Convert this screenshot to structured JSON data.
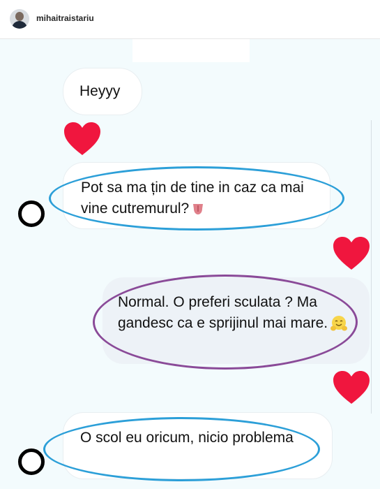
{
  "header": {
    "username": "mihaitraistariu"
  },
  "messages": [
    {
      "text": "Heyyy"
    },
    {
      "text": "Pot sa ma țin de tine in caz ca mai vine cutremurul?",
      "emoji_icon": "tongue-emoji-icon"
    },
    {
      "text": "Normal. O preferi sculata ? Ma gandesc ca e sprijinul mai mare.",
      "emoji_icon": "hugging-face-emoji-icon"
    },
    {
      "text": "O scol eu oricum, nicio problema"
    }
  ],
  "colors": {
    "heart": "#f0163e",
    "annotation_blue": "#2c9fd8",
    "annotation_purple": "#8a4a98",
    "marker_black": "#000000"
  }
}
